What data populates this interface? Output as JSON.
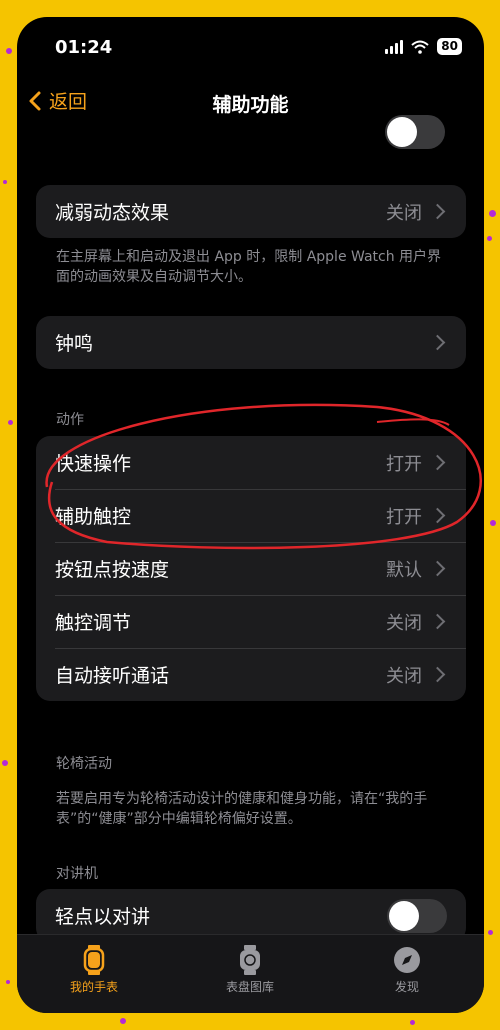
{
  "status": {
    "time": "01:24",
    "battery": "80"
  },
  "nav": {
    "back_label": "返回",
    "title": "辅助功能"
  },
  "group_reduce": {
    "label": "减弱动态效果",
    "value": "关闭"
  },
  "reduce_footnote": "在主屏幕上和启动及退出 App 时，限制 Apple Watch 用户界面的动画效果及自动调节大小。",
  "group_chime": {
    "label": "钟鸣"
  },
  "actions": {
    "header": "动作",
    "items": [
      {
        "label": "快速操作",
        "value": "打开"
      },
      {
        "label": "辅助触控",
        "value": "打开"
      },
      {
        "label": "按钮点按速度",
        "value": "默认"
      },
      {
        "label": "触控调节",
        "value": "关闭"
      },
      {
        "label": "自动接听通话",
        "value": "关闭"
      }
    ]
  },
  "wheelchair": {
    "header": "轮椅活动",
    "footnote": "若要启用专为轮椅活动设计的健康和健身功能，请在“我的手表”的“健康”部分中编辑轮椅偏好设置。"
  },
  "walkie": {
    "header": "对讲机",
    "tap_label": "轻点以对讲",
    "tap_on": false
  },
  "tabbar": {
    "tabs": [
      "我的手表",
      "表盘图库",
      "发现"
    ],
    "active": 0
  },
  "colors": {
    "accent": "#f6a21b",
    "annotation": "#e0262a",
    "background": "#f5c400",
    "dots": "#b42ad6"
  }
}
